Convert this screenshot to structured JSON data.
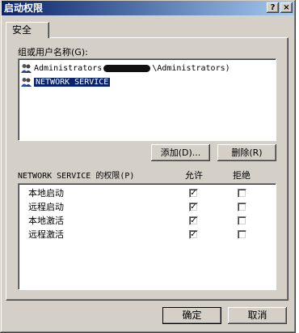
{
  "window": {
    "title": "启动权限",
    "help_button": "?",
    "close_button": "×"
  },
  "tab": {
    "label": "安全"
  },
  "users": {
    "label": "组或用户名称(G):",
    "items": [
      {
        "prefix": "Administrators",
        "suffix": "\\Administrators)",
        "selected": false
      },
      {
        "name": "NETWORK SERVICE",
        "selected": true
      }
    ],
    "add_button": "添加(D)...",
    "remove_button": "删除(R)"
  },
  "permissions": {
    "header": "NETWORK SERVICE 的权限(P)",
    "allow_header": "允许",
    "deny_header": "拒绝",
    "rows": [
      {
        "name": "本地启动",
        "allow": true,
        "deny": false
      },
      {
        "name": "远程启动",
        "allow": true,
        "deny": false
      },
      {
        "name": "本地激活",
        "allow": true,
        "deny": false
      },
      {
        "name": "远程激活",
        "allow": true,
        "deny": false
      }
    ]
  },
  "footer": {
    "ok_button": "确定",
    "cancel_button": "取消"
  },
  "colors": {
    "titlebar": "#0a246a",
    "face": "#d4d0c8",
    "selection": "#0a246a"
  }
}
